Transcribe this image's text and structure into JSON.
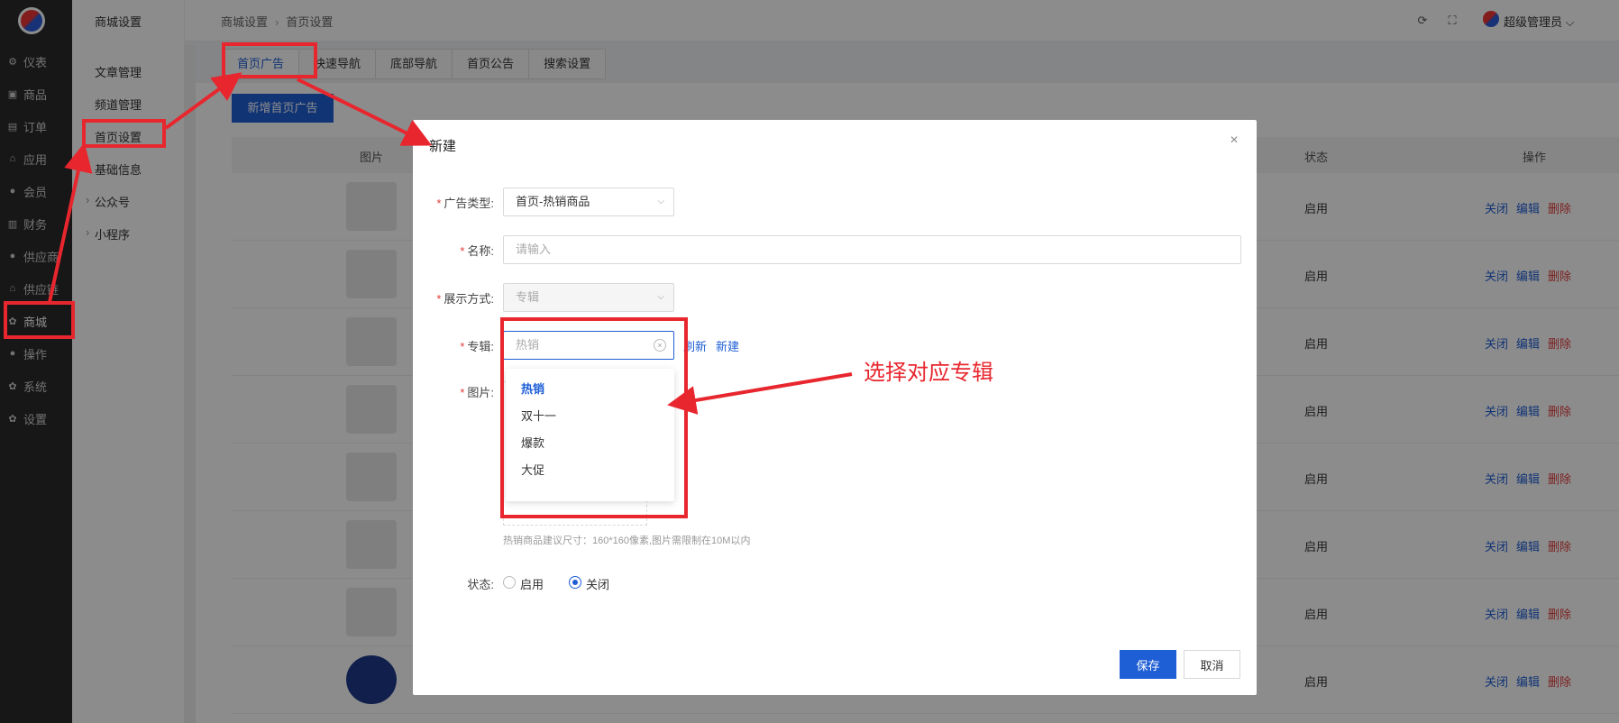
{
  "sidebar": {
    "items": [
      {
        "label": "仪表",
        "icon": "dashboard-icon"
      },
      {
        "label": "商品",
        "icon": "goods-icon"
      },
      {
        "label": "订单",
        "icon": "order-icon"
      },
      {
        "label": "应用",
        "icon": "app-icon"
      },
      {
        "label": "会员",
        "icon": "member-icon"
      },
      {
        "label": "财务",
        "icon": "finance-icon"
      },
      {
        "label": "供应商",
        "icon": "supplier-icon"
      },
      {
        "label": "供应链",
        "icon": "supply-chain-icon"
      },
      {
        "label": "商城",
        "icon": "mall-icon"
      },
      {
        "label": "操作",
        "icon": "operation-icon"
      },
      {
        "label": "系统",
        "icon": "system-icon"
      },
      {
        "label": "设置",
        "icon": "settings-icon"
      }
    ]
  },
  "submenu": {
    "title": "商城设置",
    "items": [
      "文章管理",
      "频道管理",
      "首页设置",
      "基础信息",
      "公众号",
      "小程序"
    ]
  },
  "header": {
    "breadcrumb": [
      "商城设置",
      "首页设置"
    ],
    "user": "超级管理员"
  },
  "tabs": [
    "首页广告",
    "快速导航",
    "底部导航",
    "首页公告",
    "搜索设置"
  ],
  "add_button": "新增首页广告",
  "table": {
    "headers": {
      "image": "图片",
      "status": "状态",
      "actions": "操作"
    },
    "rows": [
      {
        "status": "启用"
      },
      {
        "status": "启用"
      },
      {
        "status": "启用"
      },
      {
        "status": "启用"
      },
      {
        "status": "启用"
      },
      {
        "status": "启用"
      },
      {
        "status": "启用"
      },
      {
        "status": "启用"
      }
    ],
    "op_close": "关闭",
    "op_edit": "编辑",
    "op_delete": "删除"
  },
  "modal": {
    "title": "新建",
    "ad_type_label": "广告类型:",
    "ad_type_value": "首页-热销商品",
    "name_label": "名称:",
    "name_placeholder": "请输入",
    "display_label": "展示方式:",
    "display_value": "专辑",
    "album_label": "专辑:",
    "album_placeholder": "热销",
    "refresh_link": "刷新",
    "new_link": "新建",
    "image_label": "图片:",
    "dropdown_options": [
      "热销",
      "双十一",
      "爆款",
      "大促"
    ],
    "tip": "热销商品建议尺寸：160*160像素,图片需限制在10M以内",
    "status_label": "状态:",
    "status_on": "启用",
    "status_off": "关闭",
    "save": "保存",
    "cancel": "取消"
  },
  "annotation": {
    "text": "选择对应专辑",
    "color": "#e8262e"
  }
}
